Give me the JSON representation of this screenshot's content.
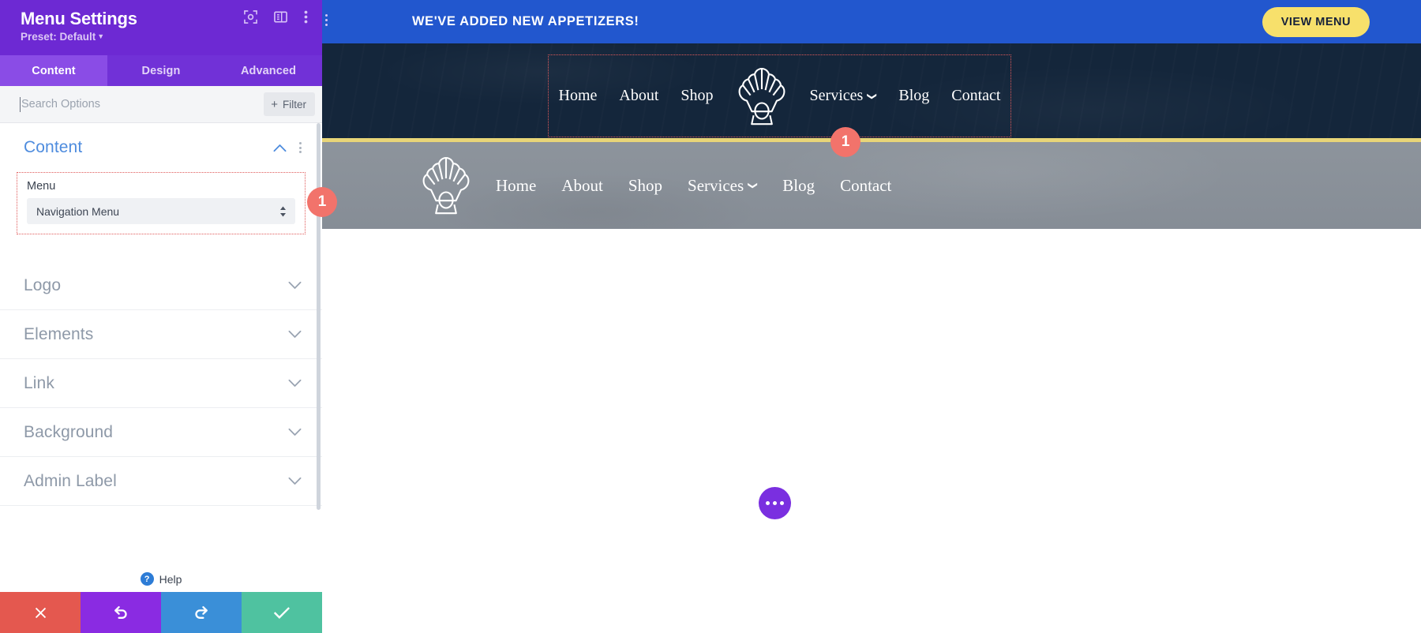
{
  "panel": {
    "title": "Menu Settings",
    "preset_label": "Preset: Default",
    "icons": {
      "focus": "focus-target-icon",
      "layout": "panel-layout-icon",
      "kebab": "more-options-icon"
    },
    "tabs": [
      {
        "label": "Content",
        "active": true
      },
      {
        "label": "Design",
        "active": false
      },
      {
        "label": "Advanced",
        "active": false
      }
    ],
    "search": {
      "placeholder": "Search Options",
      "value": ""
    },
    "filter": {
      "label": "Filter",
      "plus": "+"
    },
    "sections": [
      {
        "label": "Content",
        "open": true
      },
      {
        "label": "Logo",
        "open": false
      },
      {
        "label": "Elements",
        "open": false
      },
      {
        "label": "Link",
        "open": false
      },
      {
        "label": "Background",
        "open": false
      },
      {
        "label": "Admin Label",
        "open": false
      }
    ],
    "content_section": {
      "field_label": "Menu",
      "select_value": "Navigation Menu"
    },
    "help": {
      "label": "Help",
      "badge": "?"
    },
    "footer": {
      "cancel": "✖",
      "undo": "↺",
      "redo": "↻",
      "save": "✔"
    }
  },
  "badges": {
    "panel_marker": "1",
    "preview_marker": "1"
  },
  "preview": {
    "announcement": {
      "text": "WE'VE ADDED NEW APPETIZERS!",
      "button_label": "VIEW MENU",
      "bg_color": "#2257ce",
      "button_color": "#f7e06b"
    },
    "dark_nav": {
      "bg_color": "#14263b",
      "border_color": "#e8d578",
      "links": [
        {
          "label": "Home",
          "caret": false
        },
        {
          "label": "About",
          "caret": false
        },
        {
          "label": "Shop",
          "caret": false
        },
        {
          "label": "__LOGO__",
          "caret": false
        },
        {
          "label": "Services",
          "caret": true
        },
        {
          "label": "Blog",
          "caret": false
        },
        {
          "label": "Contact",
          "caret": false
        }
      ]
    },
    "gray_nav": {
      "bg_color": "#8d949c",
      "links": [
        {
          "label": "__LOGO__",
          "caret": false
        },
        {
          "label": "Home",
          "caret": false
        },
        {
          "label": "About",
          "caret": false
        },
        {
          "label": "Shop",
          "caret": false
        },
        {
          "label": "Services",
          "caret": true
        },
        {
          "label": "Blog",
          "caret": false
        },
        {
          "label": "Contact",
          "caret": false
        }
      ]
    },
    "fab": {
      "name": "page-settings-fab"
    }
  }
}
